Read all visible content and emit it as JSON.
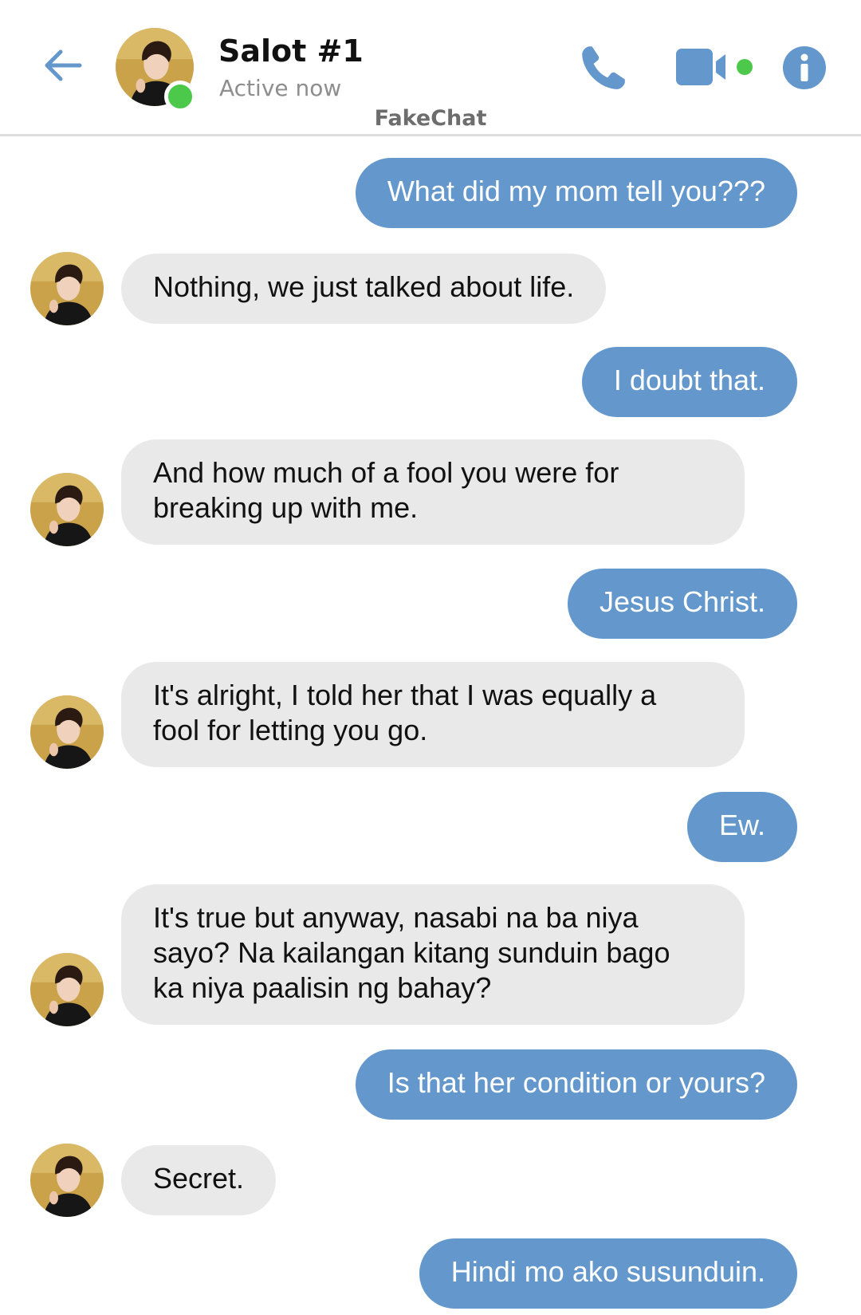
{
  "header": {
    "contact_name": "Salot #1",
    "status": "Active now",
    "watermark": "FakeChat",
    "back_icon": "arrow-left-icon",
    "call_icon": "phone-icon",
    "video_icon": "video-camera-icon",
    "info_icon": "info-icon",
    "accent_color": "#6498cc",
    "online_color": "#4cc94a"
  },
  "messages": [
    {
      "sender": "me",
      "text": "What did my mom tell you???"
    },
    {
      "sender": "them",
      "text": "Nothing, we just talked about life."
    },
    {
      "sender": "me",
      "text": "I doubt that."
    },
    {
      "sender": "them",
      "lines": [
        "And how much of a fool you were for",
        "breaking up with me."
      ]
    },
    {
      "sender": "me",
      "text": "Jesus Christ."
    },
    {
      "sender": "them",
      "lines": [
        "It's alright, I told her that I was equally a",
        "fool for letting you go."
      ]
    },
    {
      "sender": "me",
      "text": "Ew."
    },
    {
      "sender": "them",
      "lines": [
        "It's true but anyway, nasabi na ba niya",
        "sayo? Na kailangan kitang sunduin bago",
        "ka niya paalisin ng bahay?"
      ]
    },
    {
      "sender": "me",
      "text": "Is that her condition or yours?"
    },
    {
      "sender": "them",
      "text": "Secret."
    },
    {
      "sender": "me",
      "text": "Hindi mo ako susunduin."
    }
  ]
}
